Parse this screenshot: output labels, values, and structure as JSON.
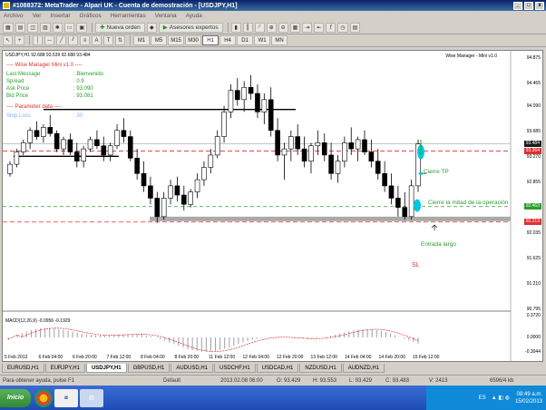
{
  "window": {
    "title": "#1088372: MetaTrader - Alpari UK - Cuenta de demostración - [USDJPY,H1]",
    "controls": [
      "_",
      "□",
      "x"
    ]
  },
  "menu": [
    "Archivo",
    "Ver",
    "Insertar",
    "Gráficos",
    "Herramientas",
    "Ventana",
    "Ayuda"
  ],
  "toolbar": {
    "new_order": "Nueva orden",
    "expert_advisors": "Asesores expertos",
    "timeframes": [
      "M1",
      "M5",
      "M15",
      "M30",
      "H1",
      "H4",
      "D1",
      "W1",
      "MN"
    ],
    "active_timeframe": "H1"
  },
  "chart": {
    "header": "USDJPY,H1  92.688 93.539 92.688 93.484",
    "name": "Wise Manager - Mini v1.0",
    "indicator": {
      "title": "---- Wise Manager Mini v1.0 ----",
      "rows": [
        {
          "label": "Last Message",
          "value": ": Bienvenido"
        },
        {
          "label": "Spread",
          "value": ": 0.9"
        },
        {
          "label": "Ask Price",
          "value": ": 93.090"
        },
        {
          "label": "Bid Price",
          "value": ": 93.081"
        }
      ],
      "param_title": "---- Parameter data ----",
      "param_rows": [
        {
          "label": "Stop Loss",
          "value": ": 30"
        }
      ]
    },
    "price_axis": [
      "94.875",
      "94.465",
      "94.090",
      "93.685",
      "93.270",
      "92.855",
      "92.450",
      "92.035",
      "91.625",
      "91.210",
      "90.795"
    ],
    "price_tags": [
      {
        "value": "93.484",
        "color": "#1c1c1c"
      },
      {
        "value": "93.364",
        "color": "#e03030"
      },
      {
        "value": "92.463",
        "color": "#2c9d2c"
      },
      {
        "value": "92.213",
        "color": "#e03030"
      }
    ],
    "annotations": {
      "tp": "Cierre TP",
      "half": "Cierre la mitad de la operación",
      "entry": "Entrada largo",
      "sl": "SL"
    },
    "macd_label": "MACD(12,26,9) -0.0956 -0.1929",
    "macd_axis": [
      "0.3720",
      "0.0000",
      "-0.3044"
    ],
    "dates": [
      "5 Feb 2013",
      "6 Feb 04:00",
      "6 Feb 20:00",
      "7 Feb 12:00",
      "8 Feb 04:00",
      "8 Feb 20:00",
      "11 Feb 12:00",
      "12 Feb 04:00",
      "12 Feb 20:00",
      "13 Feb 12:00",
      "14 Feb 04:00",
      "14 Feb 20:00",
      "15 Feb 12:00"
    ]
  },
  "tabs": [
    "EURUSD,H1",
    "EURJPY,H1",
    "USDJPY,H1",
    "GBPUSD,H1",
    "AUDUSD,H1",
    "USDCHF,H1",
    "USDCAD,H1",
    "NZDUSD,H1",
    "AUDNZD,H1"
  ],
  "active_tab": "USDJPY,H1",
  "status": {
    "help": "Para obtener ayuda, pulse F1",
    "profile": "Default",
    "datetime": "2013.02.08 06:00",
    "open": "O: 93.429",
    "high": "H: 93.553",
    "low": "L: 93.429",
    "close": "C: 93.483",
    "volume": "V: 2413",
    "traffic": "6596/4 kb"
  },
  "taskbar": {
    "start": "Inicio",
    "lang": "ES",
    "time": "08:49 a.m.",
    "date": "15/02/2013"
  },
  "candles": [
    [
      93.0,
      93.2,
      92.95,
      93.15
    ],
    [
      93.15,
      93.4,
      93.1,
      93.35
    ],
    [
      93.35,
      93.55,
      93.3,
      93.5
    ],
    [
      93.5,
      93.75,
      93.4,
      93.7
    ],
    [
      93.7,
      93.85,
      93.55,
      93.6
    ],
    [
      93.6,
      93.8,
      93.5,
      93.75
    ],
    [
      93.75,
      93.95,
      93.6,
      93.65
    ],
    [
      93.65,
      93.7,
      93.35,
      93.4
    ],
    [
      93.4,
      93.6,
      93.3,
      93.55
    ],
    [
      93.55,
      93.65,
      93.3,
      93.35
    ],
    [
      93.35,
      93.5,
      93.1,
      93.2
    ],
    [
      93.2,
      93.45,
      93.1,
      93.4
    ],
    [
      93.4,
      93.6,
      93.35,
      93.55
    ],
    [
      93.55,
      93.7,
      93.4,
      93.45
    ],
    [
      93.45,
      93.6,
      93.2,
      93.3
    ],
    [
      93.3,
      93.5,
      93.2,
      93.45
    ],
    [
      93.45,
      93.8,
      93.4,
      93.7
    ],
    [
      93.7,
      93.9,
      93.5,
      93.6
    ],
    [
      93.6,
      93.7,
      93.2,
      93.25
    ],
    [
      93.25,
      93.4,
      92.9,
      93.0
    ],
    [
      93.0,
      93.2,
      92.7,
      92.8
    ],
    [
      92.8,
      92.95,
      92.5,
      92.6
    ],
    [
      92.6,
      92.7,
      92.2,
      92.3
    ],
    [
      92.3,
      92.7,
      92.25,
      92.6
    ],
    [
      92.6,
      92.9,
      92.5,
      92.8
    ],
    [
      92.8,
      92.95,
      92.55,
      92.65
    ],
    [
      92.65,
      92.8,
      92.4,
      92.5
    ],
    [
      92.5,
      92.75,
      92.45,
      92.7
    ],
    [
      92.7,
      93.0,
      92.6,
      92.9
    ],
    [
      92.9,
      93.2,
      92.8,
      93.1
    ],
    [
      93.1,
      93.4,
      93.0,
      93.3
    ],
    [
      93.3,
      93.7,
      93.25,
      93.6
    ],
    [
      93.6,
      94.1,
      93.5,
      94.0
    ],
    [
      94.0,
      94.45,
      93.9,
      94.35
    ],
    [
      94.35,
      94.55,
      94.1,
      94.2
    ],
    [
      94.2,
      94.5,
      94.0,
      94.4
    ],
    [
      94.4,
      94.6,
      94.2,
      94.3
    ],
    [
      94.3,
      94.45,
      93.9,
      94.0
    ],
    [
      94.0,
      94.3,
      93.8,
      94.2
    ],
    [
      94.2,
      94.4,
      93.6,
      93.7
    ],
    [
      93.7,
      93.9,
      93.2,
      93.3
    ],
    [
      93.3,
      93.5,
      92.9,
      93.4
    ],
    [
      93.4,
      93.7,
      93.2,
      93.6
    ],
    [
      93.6,
      93.8,
      93.3,
      93.4
    ],
    [
      93.4,
      93.6,
      93.1,
      93.2
    ],
    [
      93.2,
      93.5,
      93.0,
      93.45
    ],
    [
      93.45,
      93.7,
      93.3,
      93.5
    ],
    [
      93.5,
      93.65,
      93.2,
      93.3
    ],
    [
      93.3,
      93.5,
      92.9,
      93.0
    ],
    [
      93.0,
      93.3,
      92.85,
      93.2
    ],
    [
      93.2,
      93.6,
      93.1,
      93.5
    ],
    [
      93.5,
      93.75,
      93.3,
      93.4
    ],
    [
      93.4,
      93.6,
      93.2,
      93.55
    ],
    [
      93.55,
      93.7,
      93.3,
      93.35
    ],
    [
      93.35,
      93.55,
      93.1,
      93.2
    ],
    [
      93.2,
      93.4,
      92.9,
      93.0
    ],
    [
      93.0,
      93.2,
      92.7,
      92.8
    ],
    [
      92.8,
      93.0,
      92.5,
      92.6
    ],
    [
      92.6,
      92.8,
      92.3,
      92.45
    ],
    [
      92.45,
      92.7,
      92.25,
      92.3
    ],
    [
      92.3,
      92.9,
      92.25,
      92.8
    ],
    [
      92.8,
      93.55,
      92.7,
      93.48
    ]
  ]
}
